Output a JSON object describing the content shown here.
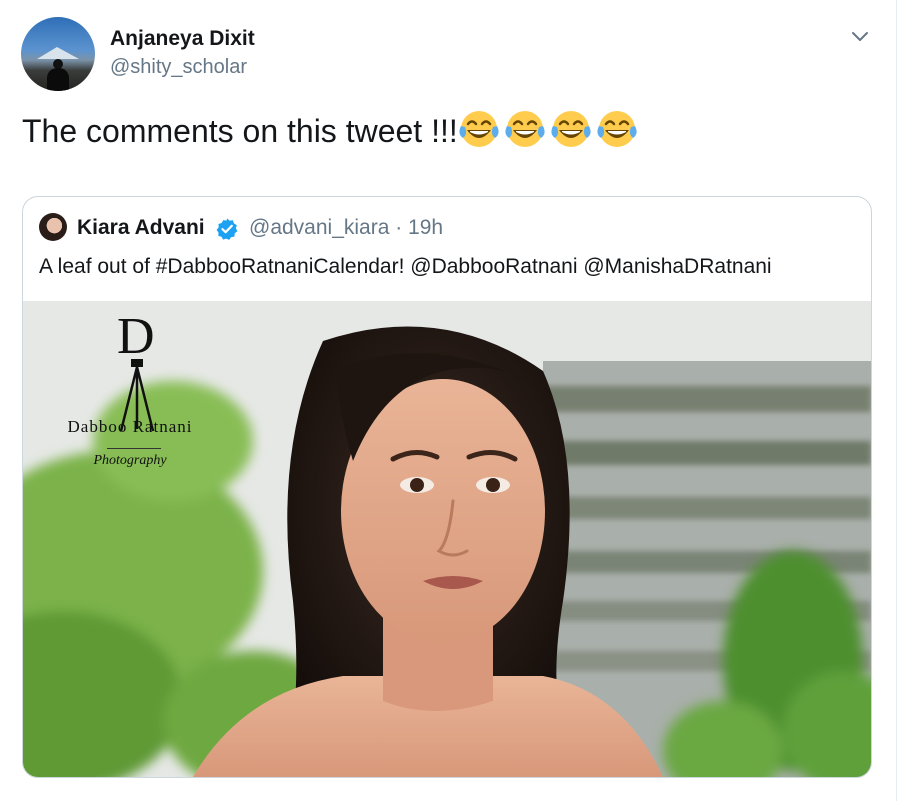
{
  "author": {
    "name": "Anjaneya Dixit",
    "handle": "@shity_scholar"
  },
  "tweet": {
    "text": "The comments on this tweet !!!",
    "emojis": [
      "face-with-tears-of-joy",
      "face-with-tears-of-joy",
      "face-with-tears-of-joy",
      "face-with-tears-of-joy"
    ]
  },
  "quoted": {
    "name": "Kiara Advani",
    "verified": true,
    "handle_time": "@advani_kiara · 19h",
    "text": "A leaf out of #DabbooRatnaniCalendar! @DabbooRatnani @ManishaDRatnani",
    "photo": {
      "logo_letter": "D",
      "logo_brand": "Dabboo Ratnani",
      "logo_sub": "Photography"
    }
  },
  "colors": {
    "text": "#14171a",
    "secondary": "#657786",
    "border": "#ccd6dd",
    "verified": "#1da1f2"
  }
}
